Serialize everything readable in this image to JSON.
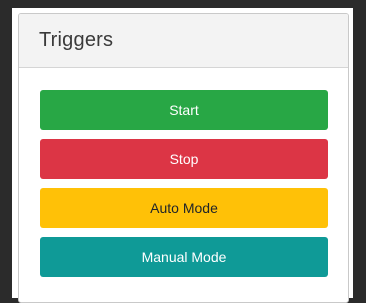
{
  "panel": {
    "title": "Triggers"
  },
  "buttons": {
    "start": "Start",
    "stop": "Stop",
    "auto_mode": "Auto Mode",
    "manual_mode": "Manual Mode"
  },
  "colors": {
    "start": "#28a745",
    "stop": "#dc3545",
    "auto_mode": "#ffc107",
    "manual_mode": "#0f9a97"
  }
}
